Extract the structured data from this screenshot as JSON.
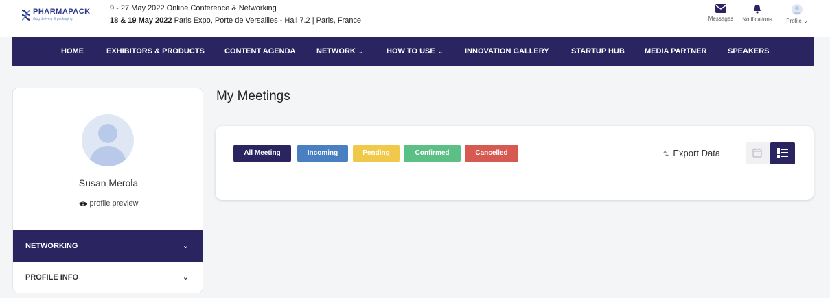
{
  "brand": {
    "name": "PHARMAPACK",
    "tagline": "drug delivery & packaging",
    "color": "#2c3588"
  },
  "event": {
    "online_dates": "9 - 27 May 2022",
    "online_label": "Online Conference & Networking",
    "onsite_dates": "18 & 19 May 2022",
    "onsite_venue": "Paris Expo, Porte de Versailles - Hall 7.2 | Paris, France"
  },
  "top_actions": {
    "messages": "Messages",
    "notifications": "Notifications",
    "profile": "Profile"
  },
  "nav": {
    "items": [
      {
        "label": "HOME"
      },
      {
        "label": "EXHIBITORS & PRODUCTS"
      },
      {
        "label": "CONTENT AGENDA"
      },
      {
        "label": "NETWORK"
      },
      {
        "label": "HOW TO USE"
      },
      {
        "label": "INNOVATION GALLERY"
      },
      {
        "label": "STARTUP HUB"
      },
      {
        "label": "MEDIA PARTNER"
      },
      {
        "label": "SPEAKERS"
      }
    ]
  },
  "sidebar": {
    "user_name": "Susan Merola",
    "profile_preview": "profile preview",
    "sections": [
      {
        "label": "NETWORKING"
      },
      {
        "label": "PROFILE INFO"
      }
    ]
  },
  "main": {
    "title": "My Meetings",
    "filters": {
      "all": "All Meeting",
      "incoming": "Incoming",
      "pending": "Pending",
      "confirmed": "Confirmed",
      "cancelled": "Cancelled"
    },
    "export_label": "Export Data"
  },
  "colors": {
    "primary": "#2a2560",
    "incoming": "#4a7fc1",
    "pending": "#f0c94a",
    "confirmed": "#5cbf86",
    "cancelled": "#d65a52"
  }
}
